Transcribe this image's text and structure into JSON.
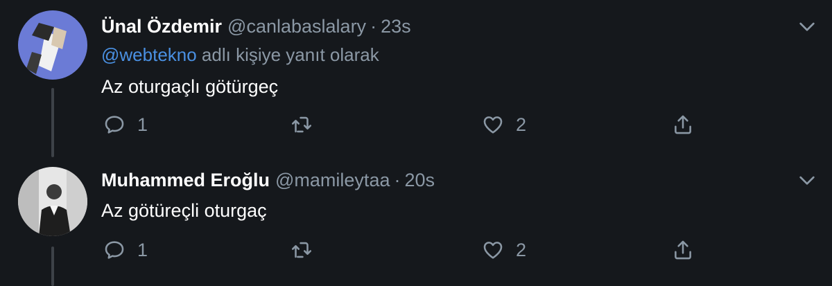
{
  "tweets": [
    {
      "name": "Ünal Özdemir",
      "handle": "@canlabaslalary",
      "separator": "·",
      "time": "23s",
      "reply_to": {
        "mention": "@webtekno",
        "suffix": " adlı kişiye yanıt olarak"
      },
      "text": "Az oturgaçlı götürgeç",
      "actions": {
        "replies": "1",
        "likes": "2"
      }
    },
    {
      "name": "Muhammed Eroğlu",
      "handle": "@mamileytaa",
      "separator": "·",
      "time": "20s",
      "text": "Az götüreçli oturgaç",
      "actions": {
        "replies": "1",
        "likes": "2"
      }
    }
  ],
  "icons": {
    "reply": "reply-icon",
    "retweet": "retweet-icon",
    "like": "heart-icon",
    "share": "share-icon",
    "more": "chevron-down-icon"
  },
  "colors": {
    "background": "#15181c",
    "text_primary": "#ffffff",
    "text_secondary": "#8b98a5",
    "link": "#4a90e2"
  }
}
